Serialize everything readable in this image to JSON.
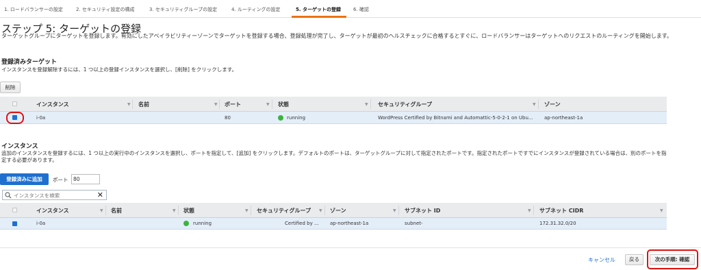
{
  "wizard": {
    "steps": [
      "1. ロードバランサーの設定",
      "2. セキュリティ設定の構成",
      "3. セキュリティグループの設定",
      "4. ルーティングの設定",
      "5. ターゲットの登録",
      "6. 確認"
    ],
    "active_step": 4,
    "accent_color": "#ec7211"
  },
  "page": {
    "title": "ステップ 5: ターゲットの登録",
    "intro": "ターゲットグループにターゲットを登録します。有効にしたアベイラビリティーゾーンでターゲットを登録する場合、登録処理が完了し、ターゲットが最初のヘルスチェックに合格するとすぐに、ロードバランサーはターゲットへのリクエストのルーティングを開始します。"
  },
  "registered": {
    "title": "登録済みターゲット",
    "desc": "インスタンスを登録解除するには、1 つ以上の登録インスタンスを選択し、[削除] をクリックします。",
    "remove_label": "削除",
    "columns": [
      "インスタンス",
      "名前",
      "ポート",
      "状態",
      "セキュリティグループ",
      "ゾーン"
    ],
    "rows": [
      {
        "instance": "i-0a",
        "name": "",
        "port": "80",
        "status": "running",
        "security_group": "WordPress Certified by Bitnami and Automattic-5-0-2-1 on Ubu...",
        "zone": "ap-northeast-1a"
      }
    ]
  },
  "instances": {
    "title": "インスタンス",
    "desc": "追加のインスタンスを登録するには、1 つ以上の実行中のインスタンスを選択し、ポートを指定して、[追加] をクリックします。デフォルトのポートは、ターゲットグループに対して指定されたポートです。指定されたポートですでにインスタンスが登録されている場合は、別のポートを指定する必要があります。",
    "add_label": "登録済みに追加",
    "port_label": "ポート",
    "port_value": "80",
    "search_placeholder": "インスタンスを検索",
    "columns": [
      "インスタンス",
      "名前",
      "状態",
      "セキュリティグループ",
      "ゾーン",
      "サブネット ID",
      "サブネット CIDR"
    ],
    "rows": [
      {
        "instance": "i-0a",
        "name": "",
        "status": "running",
        "security_group": "Certified by ...",
        "zone": "ap-northeast-1a",
        "subnet_id": "subnet-",
        "subnet_cidr": "172.31.32.0/20"
      }
    ]
  },
  "footer": {
    "cancel_label": "キャンセル",
    "back_label": "戻る",
    "next_label": "次の手順: 確認"
  },
  "colors": {
    "primary": "#1f6fcf",
    "selected_row": "#e4eef9",
    "running": "#3cb43c",
    "highlight_ring": "#e01010"
  }
}
